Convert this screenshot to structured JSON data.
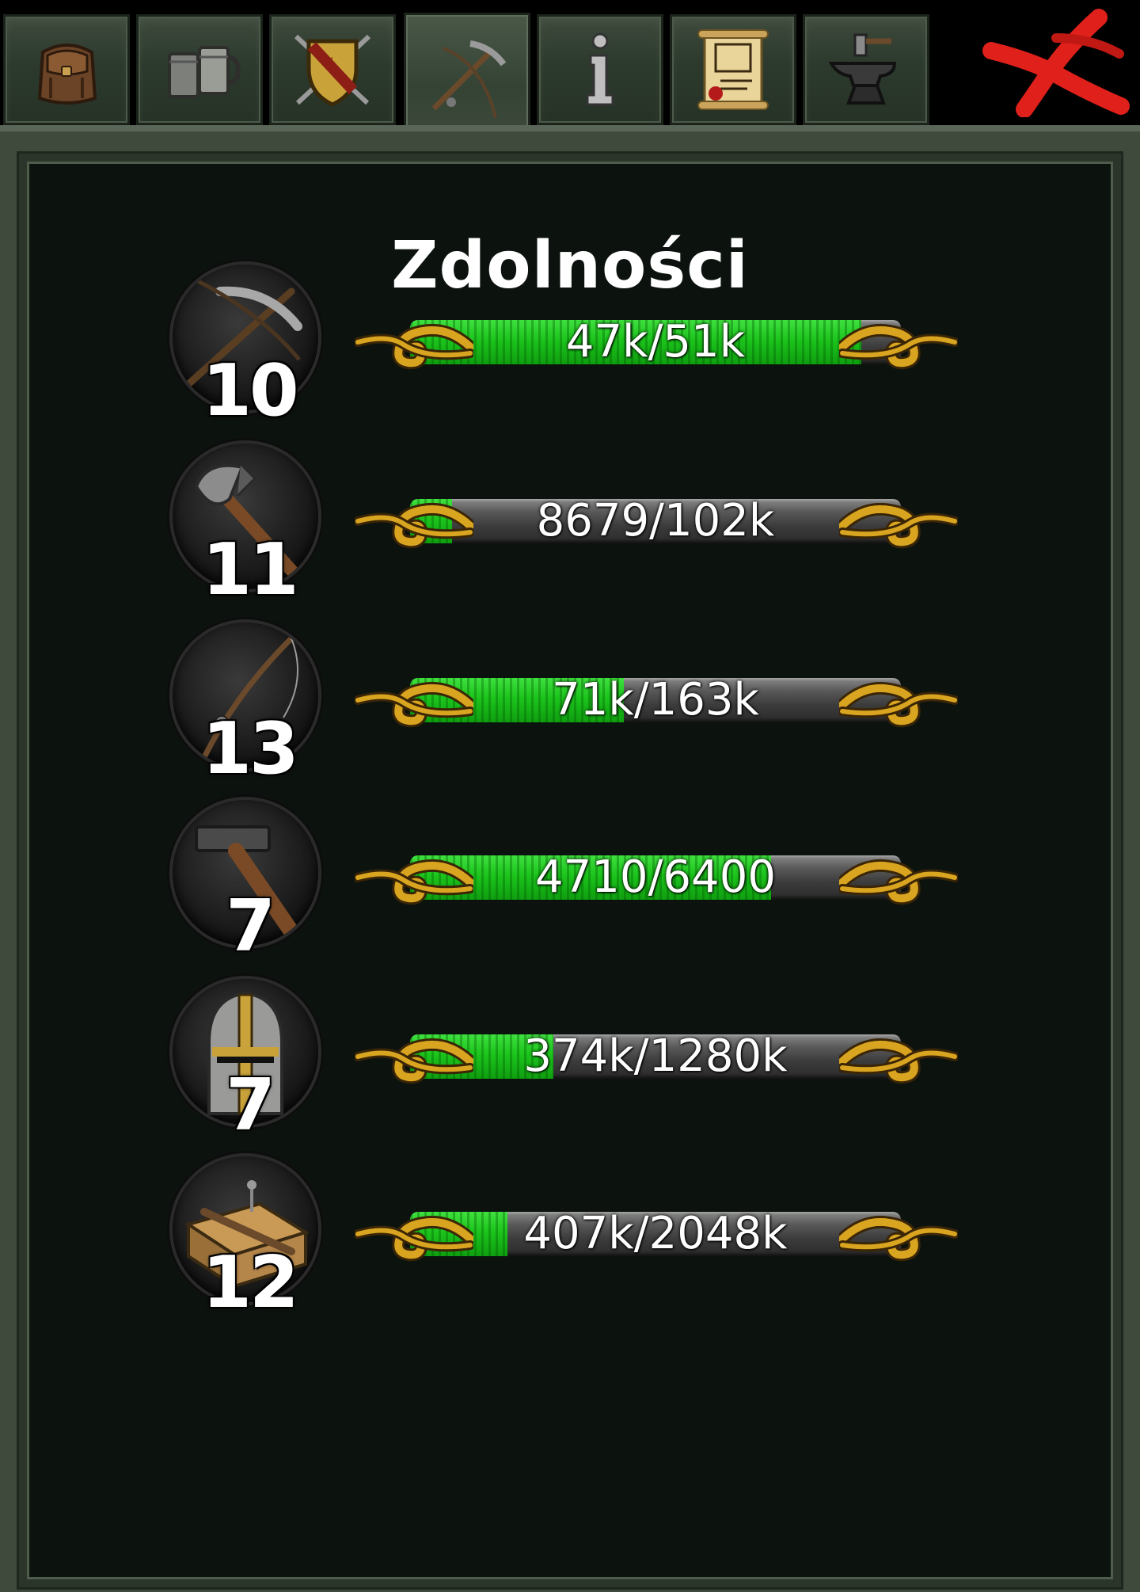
{
  "tabs": [
    {
      "icon": "backpack-icon",
      "label": "Inventory"
    },
    {
      "icon": "tankards-icon",
      "label": "Tavern"
    },
    {
      "icon": "crest-shield-icon",
      "label": "Guild"
    },
    {
      "icon": "tools-icon",
      "label": "Skills",
      "active": true
    },
    {
      "icon": "info-icon",
      "label": "Info"
    },
    {
      "icon": "scroll-map-icon",
      "label": "Quests"
    },
    {
      "icon": "anvil-icon",
      "label": "Crafting"
    }
  ],
  "close_icon": "close-x-icon",
  "panel": {
    "title": "Zdolności"
  },
  "skills": [
    {
      "icon": "pickaxe-icon",
      "level": "10",
      "progress_text": "47k/51k",
      "progress_fraction": 0.92
    },
    {
      "icon": "axe-icon",
      "level": "11",
      "progress_text": "8679/102k",
      "progress_fraction": 0.085
    },
    {
      "icon": "fishing-rod-icon",
      "level": "13",
      "progress_text": "71k/163k",
      "progress_fraction": 0.435
    },
    {
      "icon": "hammer-icon",
      "level": "7",
      "progress_text": "4710/6400",
      "progress_fraction": 0.736
    },
    {
      "icon": "helmet-icon",
      "level": "7",
      "progress_text": "374k/1280k",
      "progress_fraction": 0.292
    },
    {
      "icon": "crafting-bench-icon",
      "level": "12",
      "progress_text": "407k/2048k",
      "progress_fraction": 0.199
    }
  ],
  "colors": {
    "progress_fill": "#1cc41c",
    "close_x": "#e0201a",
    "scroll_gold": "#d9a520",
    "panel_bg": "#0c130e"
  }
}
